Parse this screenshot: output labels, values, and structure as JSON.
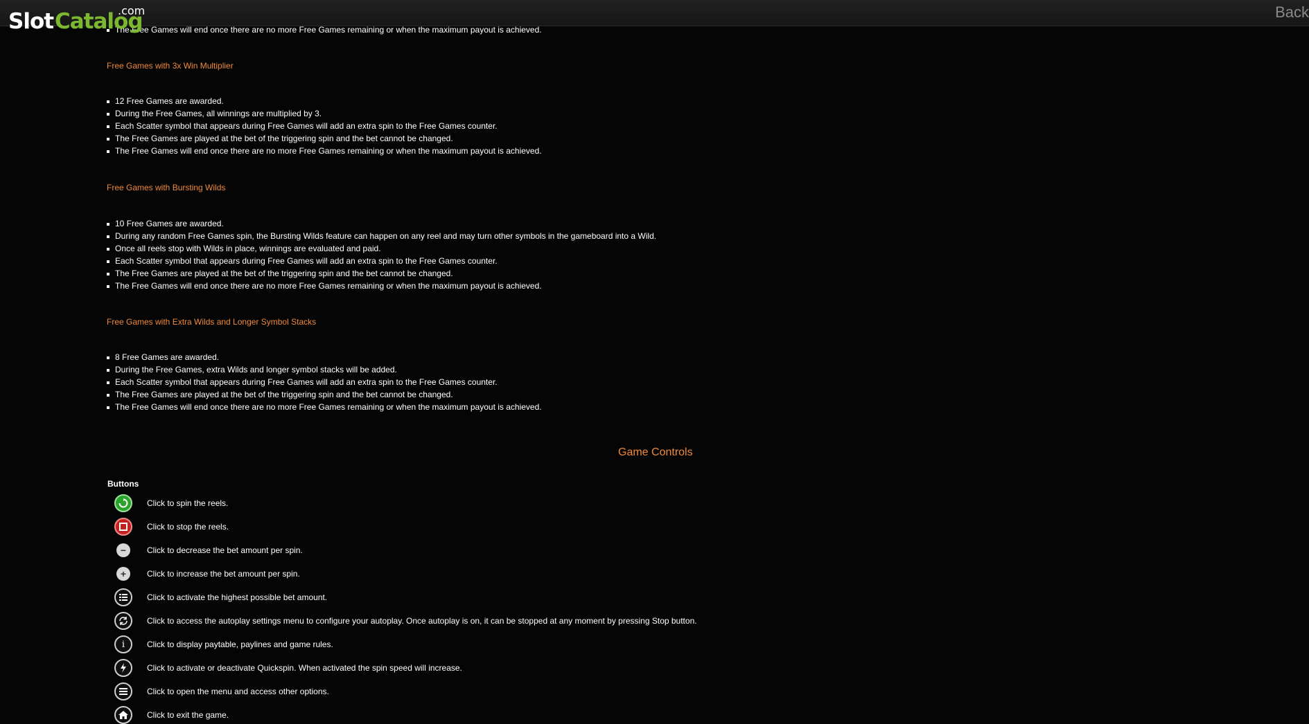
{
  "header": {
    "logo_slot": "Slot",
    "logo_catalog": "Catalog",
    "logo_dotcom": ".com",
    "back_label": "Back"
  },
  "top_partial_line": "The Free Games will end once there are no more Free Games remaining or when the maximum payout is achieved.",
  "sections": [
    {
      "heading": "Free Games with 3x Win Multiplier",
      "items": [
        "12 Free Games are awarded.",
        "During the Free Games, all winnings are multiplied by 3.",
        "Each Scatter symbol that appears during Free Games will add an extra spin to the Free Games counter.",
        "The Free Games are played at the bet of the triggering spin and the bet cannot be changed.",
        "The Free Games will end once there are no more Free Games remaining or when the maximum payout is achieved."
      ]
    },
    {
      "heading": "Free Games with Bursting Wilds",
      "items": [
        "10 Free Games are awarded.",
        "During any random Free Games spin, the Bursting Wilds feature can happen on any reel and may turn other symbols in the gameboard into a Wild.",
        "Once all reels stop with Wilds in place, winnings are evaluated and paid.",
        "Each Scatter symbol that appears during Free Games will add an extra spin to the Free Games counter.",
        "The Free Games are played at the bet of the triggering spin and the bet cannot be changed.",
        "The Free Games will end once there are no more Free Games remaining or when the maximum payout is achieved."
      ]
    },
    {
      "heading": "Free Games with Extra Wilds and Longer Symbol Stacks",
      "items": [
        "8 Free Games are awarded.",
        "During the Free Games, extra Wilds and longer symbol stacks will be added.",
        "Each Scatter symbol that appears during Free Games will add an extra spin to the Free Games counter.",
        "The Free Games are played at the bet of the triggering spin and the bet cannot be changed.",
        "The Free Games will end once there are no more Free Games remaining or when the maximum payout is achieved."
      ]
    }
  ],
  "game_controls": {
    "heading": "Game Controls",
    "buttons_label": "Buttons",
    "buttons": [
      {
        "icon": "spin-icon",
        "text": "Click to spin the reels."
      },
      {
        "icon": "stop-icon",
        "text": "Click to stop the reels."
      },
      {
        "icon": "minus-icon",
        "text": "Click to decrease the bet amount per spin."
      },
      {
        "icon": "plus-icon",
        "text": "Click to increase the bet amount per spin."
      },
      {
        "icon": "max-bet-icon",
        "text": "Click to activate the highest possible bet amount."
      },
      {
        "icon": "autoplay-icon",
        "text": "Click to access the autoplay settings menu to configure your autoplay. Once autoplay is on, it can be stopped at any moment by pressing Stop button."
      },
      {
        "icon": "info-icon",
        "text": "Click to display paytable, paylines and game rules."
      },
      {
        "icon": "quickspin-icon",
        "text": "Click to activate or deactivate Quickspin. When activated the spin speed will increase."
      },
      {
        "icon": "menu-icon",
        "text": "Click to open the menu and access other options."
      },
      {
        "icon": "home-icon",
        "text": "Click to exit the game."
      }
    ]
  }
}
